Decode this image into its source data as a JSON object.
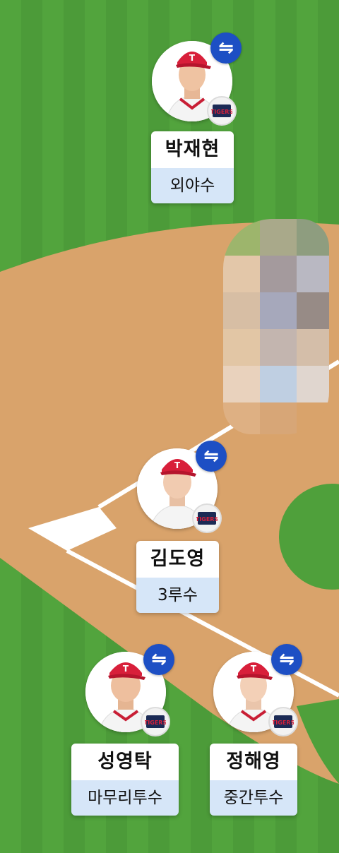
{
  "colors": {
    "grass": "#4fa03b",
    "dirt": "#d9a36b",
    "line": "#ffffff",
    "swap_button": "#1d4fc4",
    "position_bg": "#d6e6f8",
    "cap": "#d81f3a"
  },
  "players": [
    {
      "name": "박재현",
      "position": "외야수",
      "swap_icon": "⇋",
      "team_logo": "TIGERS"
    },
    {
      "name": "김도영",
      "position": "3루수",
      "swap_icon": "⇋",
      "team_logo": "TIGERS"
    },
    {
      "name": "성영탁",
      "position": "마무리투수",
      "swap_icon": "⇋",
      "team_logo": "TIGERS"
    },
    {
      "name": "정해영",
      "position": "중간투수",
      "swap_icon": "⇋",
      "team_logo": "TIGERS"
    }
  ]
}
